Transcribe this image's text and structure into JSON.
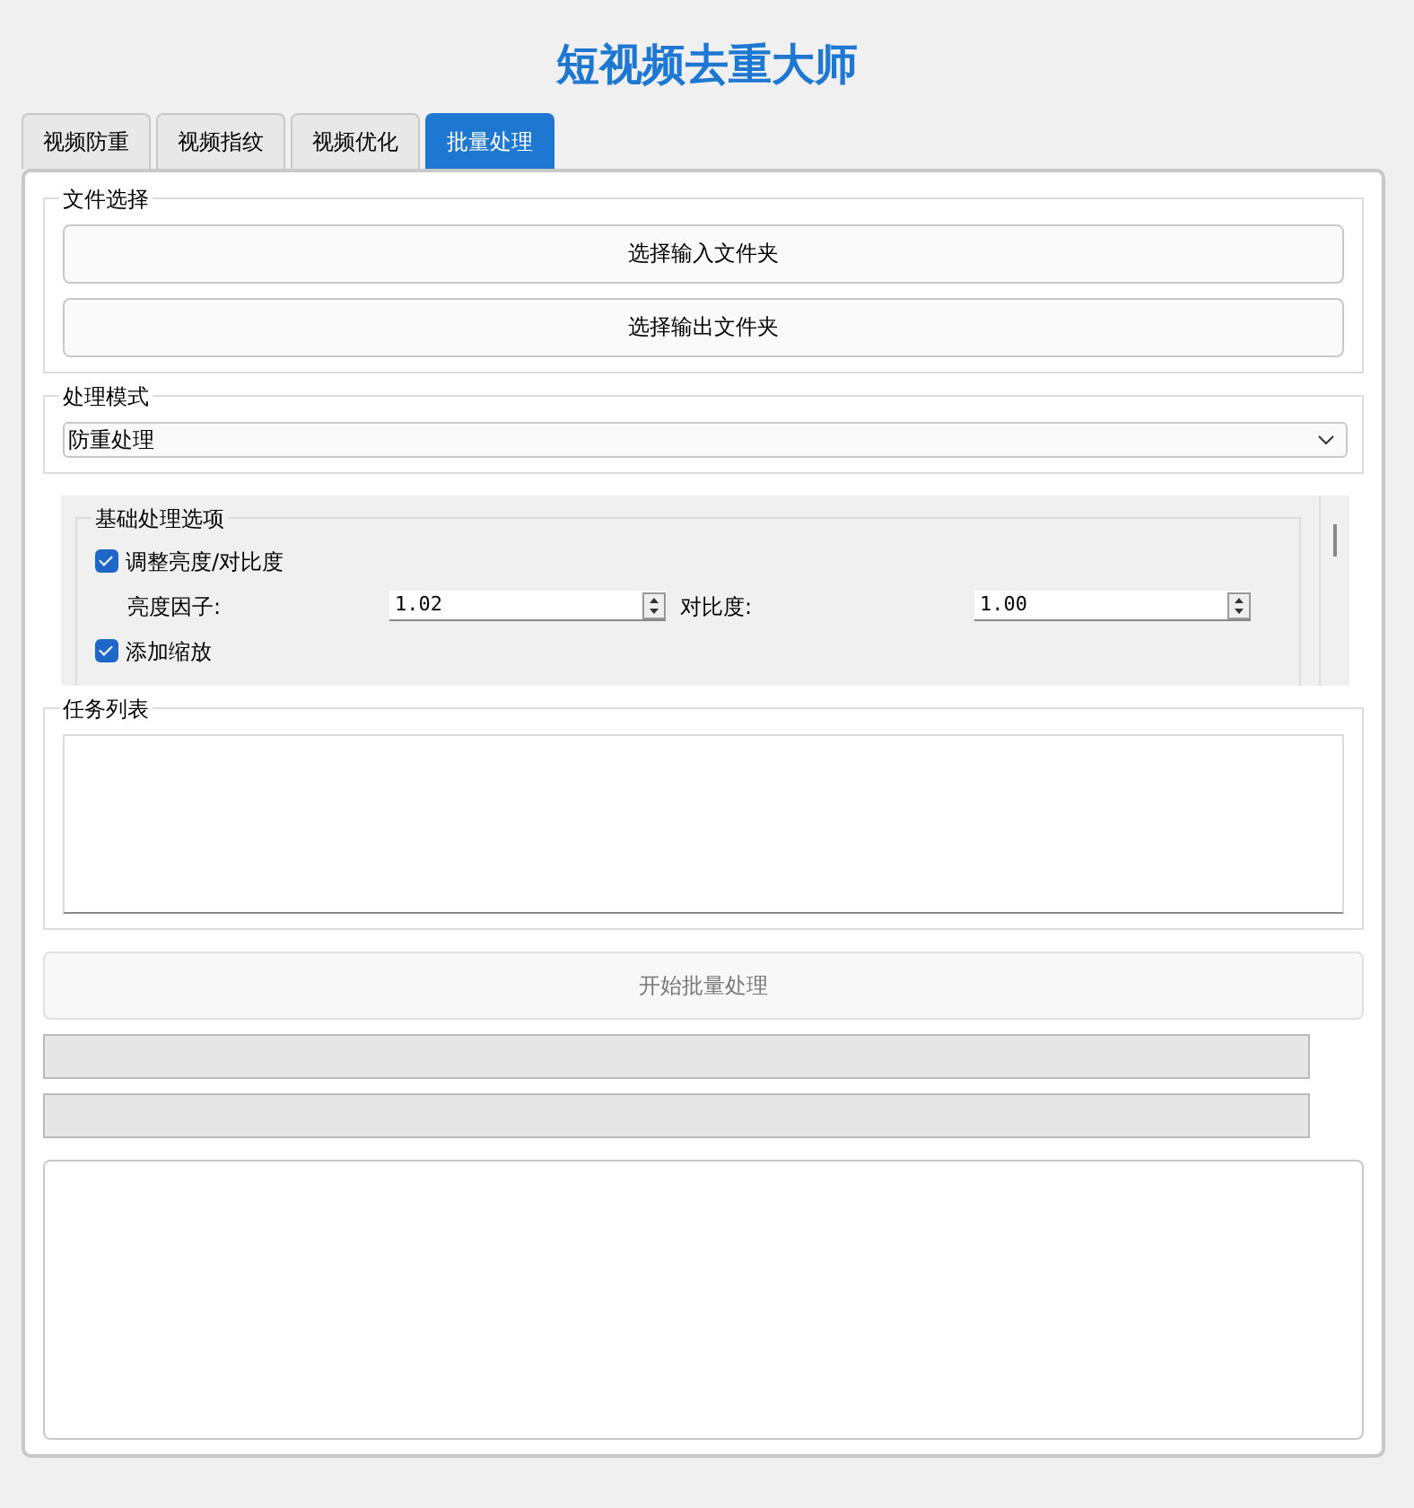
{
  "title": "短视频去重大师",
  "tabs": [
    {
      "label": "视频防重",
      "selected": false
    },
    {
      "label": "视频指纹",
      "selected": false
    },
    {
      "label": "视频优化",
      "selected": false
    },
    {
      "label": "批量处理",
      "selected": true
    }
  ],
  "file_group": {
    "title": "文件选择",
    "buttons": [
      "选择输入文件夹",
      "选择输出文件夹"
    ]
  },
  "mode_group": {
    "title": "处理模式",
    "value": "防重处理"
  },
  "options_group": {
    "title": "基础处理选项",
    "items": [
      {
        "kind": "checkbox",
        "label": "调整亮度/对比度",
        "checked": true
      },
      {
        "kind": "spin_pair",
        "fields": [
          {
            "label": "亮度因子:",
            "value": "1.02"
          },
          {
            "label": "对比度:",
            "value": "1.00"
          }
        ]
      },
      {
        "kind": "checkbox",
        "label": "添加缩放",
        "checked": true
      }
    ]
  },
  "task_group": {
    "title": "任务列表"
  },
  "start_button": {
    "label": "开始批量处理",
    "disabled": true
  },
  "progress_bars": [
    {
      "level": 0
    },
    {
      "level": 0
    }
  ]
}
